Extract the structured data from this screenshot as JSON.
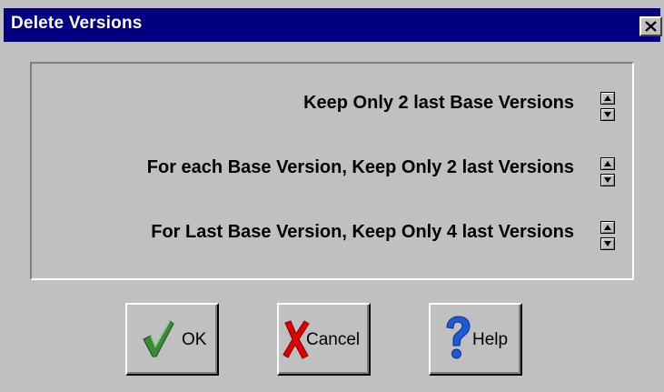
{
  "window": {
    "title": "Delete Versions"
  },
  "settings": {
    "rows": [
      {
        "label": "Keep Only 2 last Base Versions"
      },
      {
        "label": "For each Base Version, Keep Only 2 last Versions"
      },
      {
        "label": "For Last Base Version, Keep Only 4 last Versions"
      }
    ]
  },
  "buttons": {
    "ok_label": "OK",
    "cancel_label": "Cancel",
    "help_label": "Help"
  },
  "icons": {
    "ok": "checkmark-icon",
    "cancel": "red-x-icon",
    "help": "question-mark-icon",
    "close": "close-icon",
    "spin_up": "arrow-up-icon",
    "spin_down": "arrow-down-icon"
  },
  "colors": {
    "titlebar": "#000080",
    "dialog": "#c0c0c0",
    "ok_check": "#3a8a3a",
    "cancel_x": "#e00000",
    "help_q": "#1e5ad8"
  }
}
